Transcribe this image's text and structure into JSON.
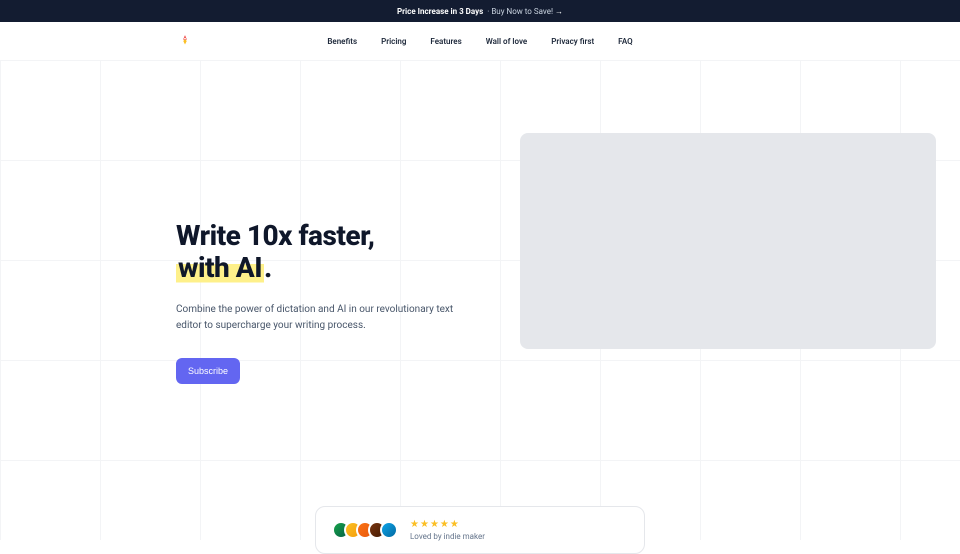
{
  "banner": {
    "bold": "Price Increase in 3 Days",
    "text": " ·  Buy Now to Save!",
    "arrow": "→"
  },
  "nav": {
    "items": [
      "Benefits",
      "Pricing",
      "Features",
      "Wall of love",
      "Privacy first",
      "FAQ"
    ]
  },
  "hero": {
    "title_line1": "Write 10x faster,",
    "title_highlight": "with AI",
    "title_period": ".",
    "subtitle": "Combine the power of dictation and AI in our revolutionary text editor to supercharge your writing process.",
    "cta": "Subscribe"
  },
  "social": {
    "loved_label": "Loved by indie maker"
  }
}
